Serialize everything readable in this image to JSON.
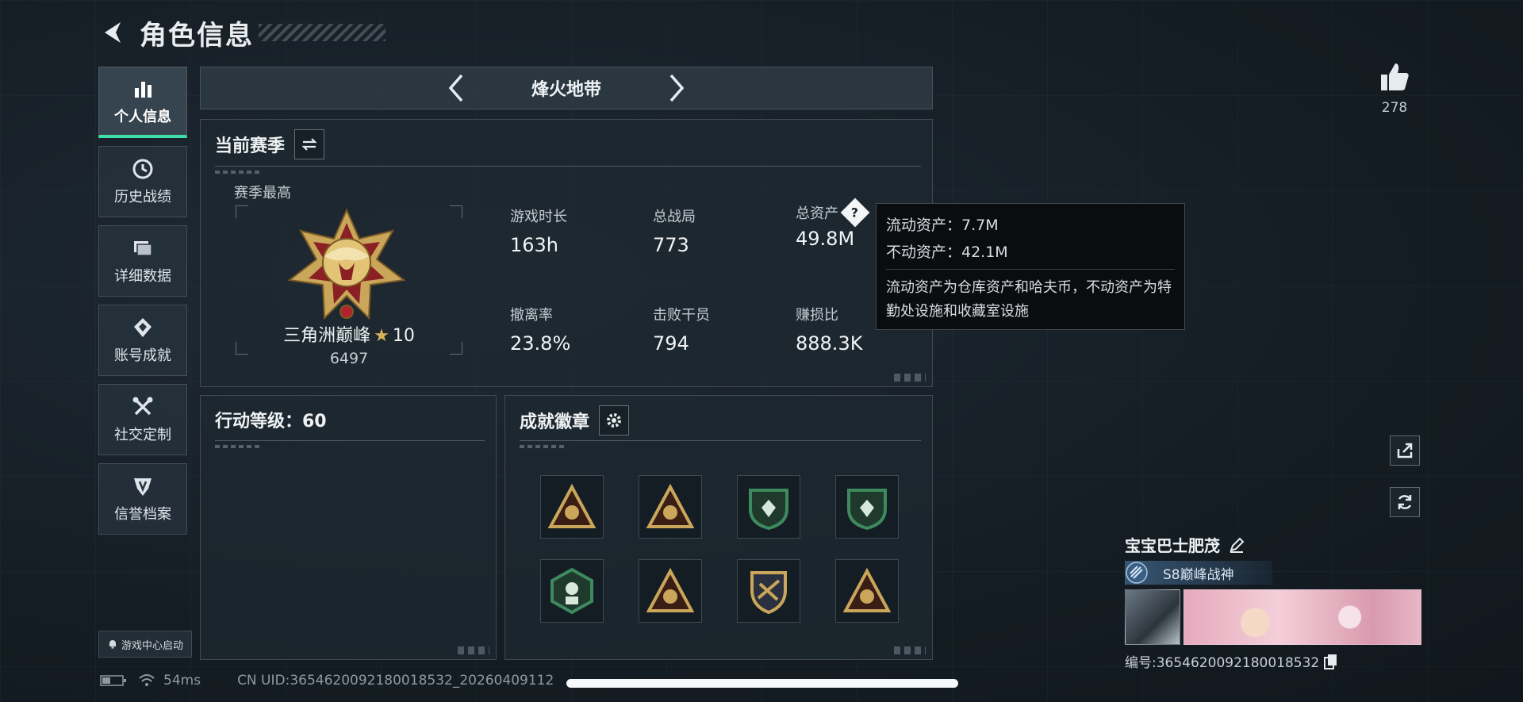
{
  "header": {
    "title": "角色信息"
  },
  "sidebar": {
    "items": [
      {
        "label": "个人信息",
        "icon": "bar-chart-icon",
        "active": true
      },
      {
        "label": "历史战绩",
        "icon": "history-icon"
      },
      {
        "label": "详细数据",
        "icon": "folder-icon"
      },
      {
        "label": "账号成就",
        "icon": "achievement-icon"
      },
      {
        "label": "社交定制",
        "icon": "tools-icon"
      },
      {
        "label": "信誉档案",
        "icon": "shield-icon"
      }
    ]
  },
  "mode": {
    "title": "烽火地带"
  },
  "season": {
    "title": "当前赛季",
    "best_label": "赛季最高",
    "rank_name": "三角洲巅峰",
    "rank_stars": "10",
    "rank_score": "6497",
    "stats": [
      {
        "label": "游戏时长",
        "value": "163h"
      },
      {
        "label": "总战局",
        "value": "773"
      },
      {
        "label": "总资产",
        "value": "49.8M"
      },
      {
        "label": "撤离率",
        "value": "23.8%"
      },
      {
        "label": "击败干员",
        "value": "794"
      },
      {
        "label": "赚损比",
        "value": "888.3K"
      }
    ],
    "help_symbol": "?"
  },
  "tooltip": {
    "line1": "流动资产：7.7M",
    "line2": "不动资产：42.1M",
    "desc": "流动资产为仓库资产和哈夫币，不动资产为特勤处设施和收藏室设施"
  },
  "level": {
    "title": "行动等级：60"
  },
  "badges": {
    "title": "成就徽章",
    "items": [
      {
        "name": "badge-1",
        "shape": "triangle",
        "color": "#c9a65a"
      },
      {
        "name": "badge-2",
        "shape": "triangle",
        "color": "#c9a65a"
      },
      {
        "name": "badge-3",
        "shape": "shield",
        "color": "#3e8a5f"
      },
      {
        "name": "badge-4",
        "shape": "shield",
        "color": "#3e8a5f"
      },
      {
        "name": "badge-5",
        "shape": "hexagon",
        "color": "#3e8a5f"
      },
      {
        "name": "badge-6",
        "shape": "triangle",
        "color": "#c9a65a"
      },
      {
        "name": "badge-7",
        "shape": "crest",
        "color": "#c9a65a"
      },
      {
        "name": "badge-8",
        "shape": "triangle",
        "color": "#c9a65a"
      }
    ]
  },
  "game_center": {
    "label": "游戏中心启动"
  },
  "status": {
    "ping": "54ms",
    "uid": "CN UID:3654620092180018532_20260409112"
  },
  "likes": {
    "count": "278"
  },
  "profile": {
    "name": "宝宝巴士肥茂",
    "title": "S8巅峰战神",
    "id_line": "编号:3654620092180018532"
  },
  "colors": {
    "accent": "#3fe0a8",
    "gold": "#c9a65a"
  }
}
